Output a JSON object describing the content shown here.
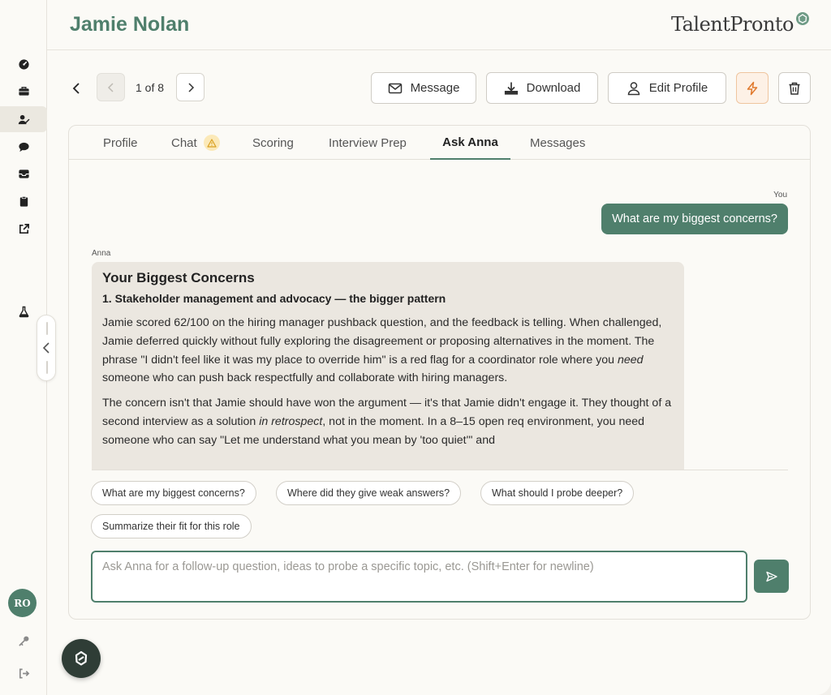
{
  "header": {
    "title": "Jamie Nolan",
    "brand": "TalentPronto"
  },
  "sidebar": {
    "items": [
      {
        "icon": "dashboard-icon"
      },
      {
        "icon": "briefcase-icon"
      },
      {
        "icon": "candidates-icon",
        "active": true
      },
      {
        "icon": "chat-icon"
      },
      {
        "icon": "inbox-icon"
      },
      {
        "icon": "clipboard-icon"
      },
      {
        "icon": "external-link-icon"
      },
      {
        "icon": "flask-icon"
      }
    ],
    "avatar_initials": "RO",
    "bottom": [
      {
        "icon": "key-icon"
      },
      {
        "icon": "logout-icon"
      }
    ]
  },
  "toolbar": {
    "counter": "1 of 8",
    "message": "Message",
    "download": "Download",
    "edit_profile": "Edit Profile"
  },
  "tabs": [
    {
      "label": "Profile"
    },
    {
      "label": "Chat",
      "badge": "warning"
    },
    {
      "label": "Scoring"
    },
    {
      "label": "Interview Prep"
    },
    {
      "label": "Ask Anna",
      "active": true
    },
    {
      "label": "Messages"
    }
  ],
  "chat": {
    "you_label": "You",
    "user_message": "What are my biggest concerns?",
    "anna_label": "Anna",
    "anna_heading": "Your Biggest Concerns",
    "anna_subheading": "1. Stakeholder management and advocacy — the bigger pattern",
    "p1_text": "Jamie scored 62/100 on the hiring manager pushback question, and the feedback is telling. When challenged, Jamie deferred quickly without fully exploring the disagreement or proposing alternatives in the moment. The phrase \"I didn't feel like it was my place to override him\" is a red flag for a coordinator role where you ",
    "p1_em": "need",
    "p1_tail": " someone who can push back respectfully and collaborate with hiring managers.",
    "p2_text": "The concern isn't that Jamie should have won the argument — it's that Jamie didn't engage it. They thought of a second interview as a solution ",
    "p2_em": "in retrospect",
    "p2_tail": ", not in the moment. In a 8–15 open req environment, you need someone who can say \"Let me understand what you mean by 'too quiet'\" and"
  },
  "suggestions": [
    "What are my biggest concerns?",
    "Where did they give weak answers?",
    "What should I probe deeper?",
    "Summarize their fit for this role"
  ],
  "composer": {
    "placeholder": "Ask Anna for a follow-up question, ideas to probe a specific topic, etc. (Shift+Enter for newline)",
    "value": ""
  },
  "colors": {
    "accent": "#4f7f6c",
    "bolt": "#e07a2e",
    "warning": "#d9a020"
  }
}
